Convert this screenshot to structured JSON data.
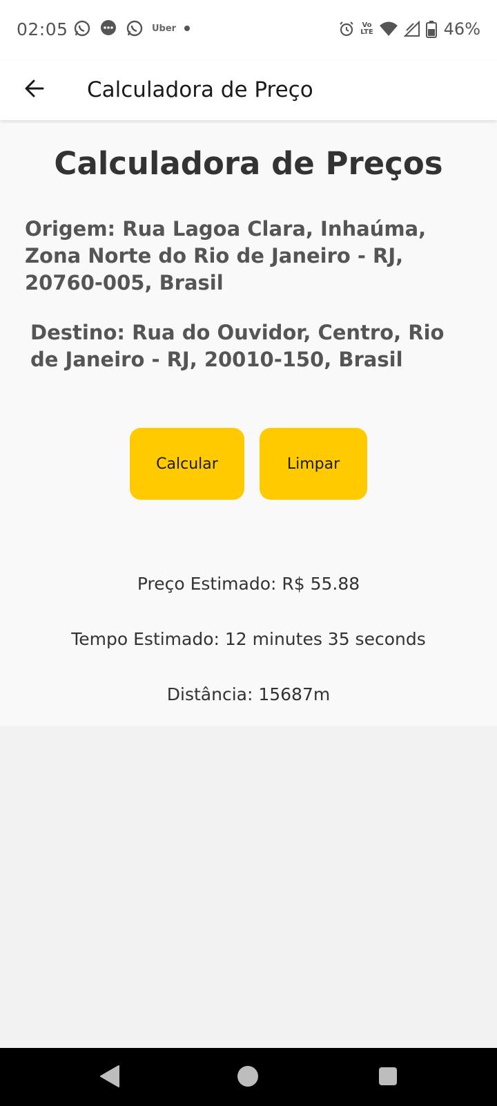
{
  "status_bar": {
    "time": "02:05",
    "uber_label": "Uber",
    "battery": "46%",
    "volte_top": "Vo",
    "volte_bottom": "LTE",
    "icons": [
      "whatsapp-icon",
      "chat-bubble-icon",
      "whatsapp-icon",
      "uber-icon",
      "dot-icon",
      "alarm-icon",
      "volte-icon",
      "wifi-icon",
      "signal-icon",
      "battery-icon"
    ]
  },
  "app_bar": {
    "title": "Calculadora de Preço"
  },
  "main": {
    "title": "Calculadora de Preços",
    "origin": "Origem: Rua Lagoa Clara, Inhaúma, Zona Norte do Rio de Janeiro - RJ, 20760-005, Brasil",
    "destination": "Destino: Rua do Ouvidor, Centro, Rio de Janeiro - RJ, 20010-150, Brasil",
    "buttons": {
      "calculate": "Calcular",
      "clear": "Limpar"
    },
    "results": {
      "price": "Preço Estimado: R$ 55.88",
      "time": "Tempo Estimado: 12 minutes 35 seconds",
      "distance": "Distância: 15687m"
    }
  },
  "colors": {
    "accent": "#FFCB00",
    "content_bg": "#f9f9f9",
    "page_bg": "#f2f2f2"
  }
}
